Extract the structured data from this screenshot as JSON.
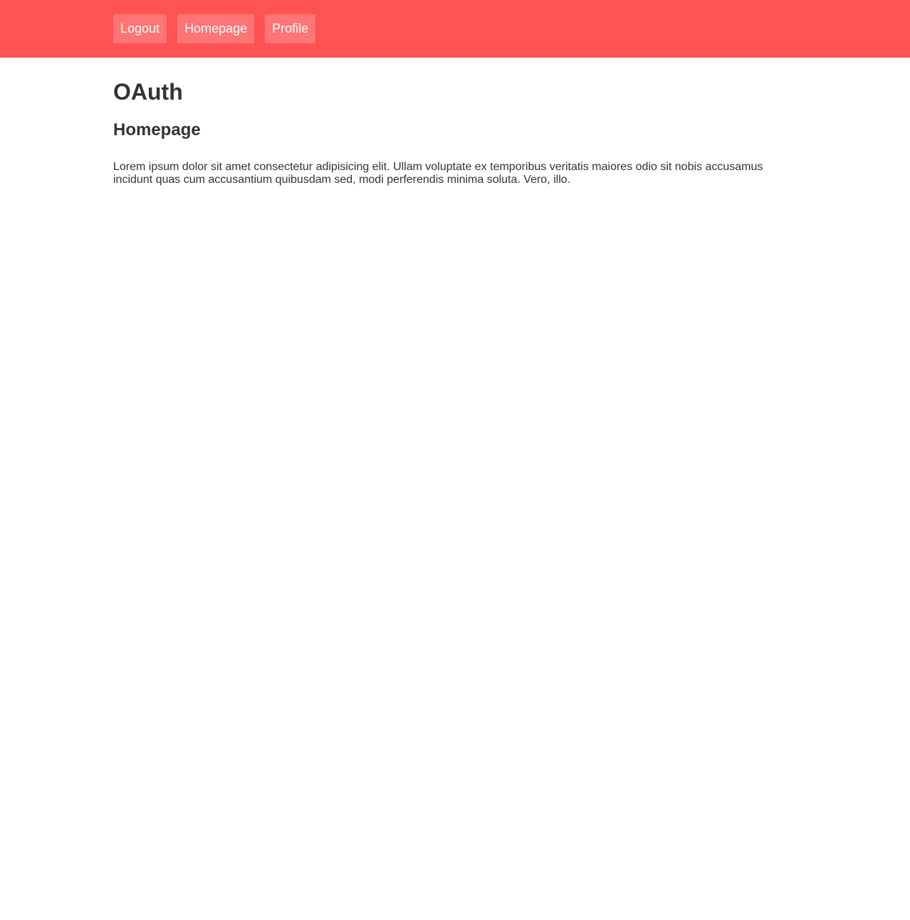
{
  "colors": {
    "navbar_background": "#ff5252",
    "nav_link_background": "#ff7474",
    "nav_link_text": "#ffffff",
    "body_text": "#333333",
    "page_background": "#ffffff"
  },
  "navbar": {
    "links": [
      {
        "label": "Logout"
      },
      {
        "label": "Homepage"
      },
      {
        "label": "Profile"
      }
    ]
  },
  "main": {
    "title": "OAuth",
    "subtitle": "Homepage",
    "paragraph": "Lorem ipsum dolor sit amet consectetur adipisicing elit. Ullam voluptate ex temporibus veritatis maiores odio sit nobis accusamus incidunt quas cum accusantium quibusdam sed, modi perferendis minima soluta. Vero, illo."
  }
}
